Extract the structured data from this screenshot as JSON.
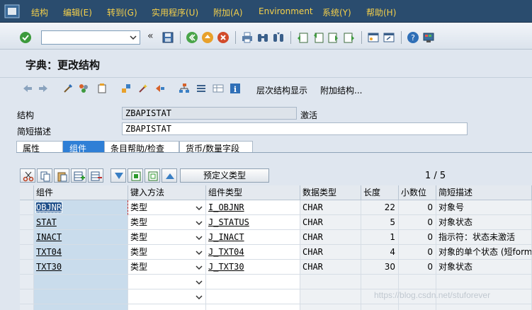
{
  "menu": {
    "items": [
      "结构(S)",
      "编辑(E)",
      "转到(G)",
      "实用程序(U)",
      "附加(A)",
      "Environment",
      "系统(Y)",
      "帮助(H)"
    ],
    "labels": [
      "结构",
      "编辑",
      "转到",
      "实用程序",
      "附加",
      "Environment",
      "系统",
      "帮助"
    ]
  },
  "menu_display": {
    "m0": "结构",
    "m1": "编辑(E)",
    "m2": "转到(G)",
    "m3": "实用程序(U)",
    "m4": "附加(A)",
    "m5": "Environment",
    "m6": "系统(Y)",
    "m7": "帮助(H)"
  },
  "command_field": {
    "value": ""
  },
  "title": "字典：更改结构",
  "app_toolbar": {
    "hierarchy_label": "层次结构显示",
    "append_label": "附加结构..."
  },
  "header": {
    "structure_label": "结构",
    "structure_value": "ZBAPISTAT",
    "status_value": "激活",
    "desc_label": "简短描述",
    "desc_value": "ZBAPISTAT"
  },
  "tabs": [
    "属性",
    "组件",
    "条目帮助/检查",
    "货币/数量字段"
  ],
  "active_tab": 1,
  "grid": {
    "predefined_type_label": "预定义类型",
    "pager": "1 / 5",
    "columns": [
      "组件",
      "键入方法",
      "组件类型",
      "数据类型",
      "长度",
      "小数位",
      "简短描述"
    ],
    "rows": [
      {
        "component": "OBJNR",
        "method": "类型",
        "ctype": "I_OBJNR",
        "dtype": "CHAR",
        "length": "22",
        "decimals": "0",
        "desc": "对象号"
      },
      {
        "component": "STAT",
        "method": "类型",
        "ctype": "J_STATUS",
        "dtype": "CHAR",
        "length": "5",
        "decimals": "0",
        "desc": "对象状态"
      },
      {
        "component": "INACT",
        "method": "类型",
        "ctype": "J_INACT",
        "dtype": "CHAR",
        "length": "1",
        "decimals": "0",
        "desc": "指示符：状态未激活"
      },
      {
        "component": "TXT04",
        "method": "类型",
        "ctype": "J_TXT04",
        "dtype": "CHAR",
        "length": "4",
        "decimals": "0",
        "desc": "对象的单个状态 (短form)"
      },
      {
        "component": "TXT30",
        "method": "类型",
        "ctype": "J_TXT30",
        "dtype": "CHAR",
        "length": "30",
        "decimals": "0",
        "desc": "对象状态"
      }
    ]
  },
  "watermark": "https://blog.csdn.net/stuforever",
  "colors": {
    "menubar": "#2a4c6e",
    "menu_text": "#f5d04a",
    "active_tab": "#2f7fd6",
    "key_column": "#c9dcec"
  },
  "icons": [
    "sap-logo-icon",
    "enter-icon",
    "save-icon",
    "back-icon",
    "exit-icon",
    "cancel-icon",
    "print-icon",
    "find-icon",
    "find-next-icon",
    "first-page-icon",
    "previous-page-icon",
    "next-page-icon",
    "last-page-icon",
    "new-session-icon",
    "shortcut-icon",
    "help-icon",
    "customize-layout-icon"
  ]
}
